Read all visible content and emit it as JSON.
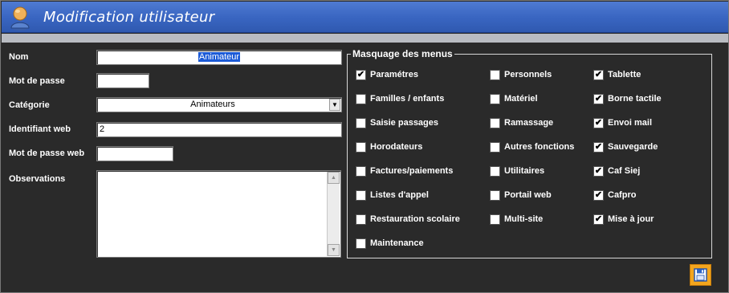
{
  "window": {
    "title": "Modification utilisateur",
    "accent_color": "#3a66c2",
    "icon": "user-icon"
  },
  "form": {
    "nom": {
      "label": "Nom",
      "value": "Animateur"
    },
    "mot_de_passe": {
      "label": "Mot de passe",
      "value": ""
    },
    "categorie": {
      "label": "Catégorie",
      "value": "Animateurs",
      "icon": "chevron-down-icon"
    },
    "identifiant_web": {
      "label": "Identifiant web",
      "value": "2"
    },
    "mot_de_passe_web": {
      "label": "Mot de passe web",
      "value": ""
    },
    "observations": {
      "label": "Observations",
      "value": ""
    }
  },
  "menus": {
    "title": "Masquage des menus",
    "columns": [
      [
        {
          "label": "Paramétres",
          "checked": true
        },
        {
          "label": "Familles / enfants",
          "checked": false
        },
        {
          "label": "Saisie passages",
          "checked": false
        },
        {
          "label": "Horodateurs",
          "checked": false
        },
        {
          "label": "Factures/paiements",
          "checked": false
        },
        {
          "label": "Listes d'appel",
          "checked": false
        },
        {
          "label": "Restauration scolaire",
          "checked": false
        },
        {
          "label": "Maintenance",
          "checked": false
        }
      ],
      [
        {
          "label": "Personnels",
          "checked": false
        },
        {
          "label": "Matériel",
          "checked": false
        },
        {
          "label": "Ramassage",
          "checked": false
        },
        {
          "label": "Autres fonctions",
          "checked": false
        },
        {
          "label": "Utilitaires",
          "checked": false
        },
        {
          "label": "Portail web",
          "checked": false
        },
        {
          "label": "Multi-site",
          "checked": false
        }
      ],
      [
        {
          "label": "Tablette",
          "checked": true
        },
        {
          "label": "Borne tactile",
          "checked": true
        },
        {
          "label": "Envoi mail",
          "checked": true
        },
        {
          "label": "Sauvegarde",
          "checked": true
        },
        {
          "label": "Caf Siej",
          "checked": true
        },
        {
          "label": "Cafpro",
          "checked": true
        },
        {
          "label": "Mise à jour",
          "checked": true
        }
      ]
    ]
  },
  "actions": {
    "save_icon": "floppy-disk-icon",
    "save_color": "#f3a51e"
  }
}
